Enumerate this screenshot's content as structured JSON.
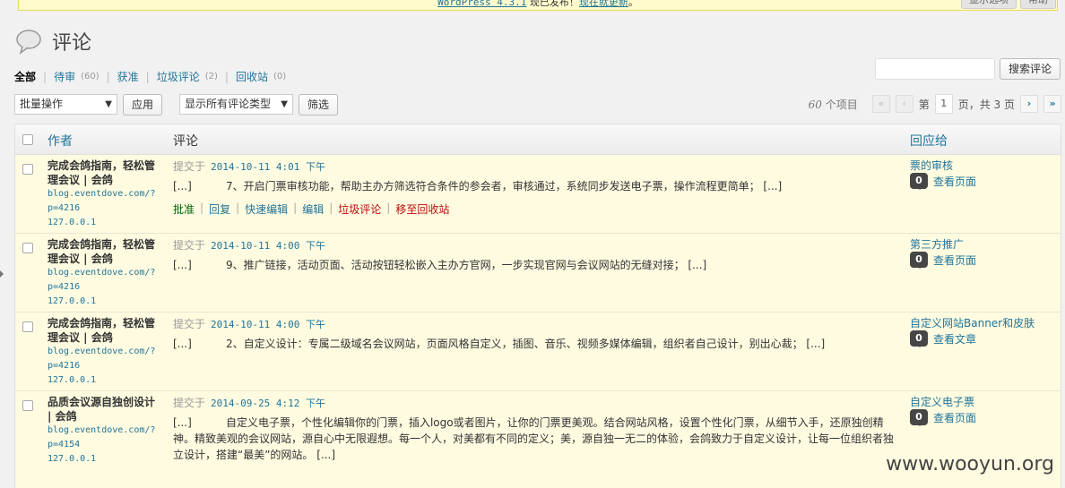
{
  "notice": {
    "product": "WordPress 4.3.1",
    "text": "现已发布！",
    "link": "现在就更新",
    "end": "。"
  },
  "screen_tabs": {
    "options": "显示选项",
    "help": "帮助"
  },
  "page": {
    "title": "评论"
  },
  "filters": [
    {
      "label": "全部",
      "count": ""
    },
    {
      "label": "待审",
      "count": "(60)"
    },
    {
      "label": "获准",
      "count": ""
    },
    {
      "label": "垃圾评论",
      "count": "(2)"
    },
    {
      "label": "回收站",
      "count": "(0)"
    }
  ],
  "search": {
    "value": "",
    "button": "搜索评论"
  },
  "tablenav": {
    "bulk": "批量操作",
    "apply": "应用",
    "type_filter": "显示所有评论类型",
    "filter": "筛选",
    "items_count": "60",
    "items_label": "个项目",
    "page_prefix": "第",
    "current_page": "1",
    "page_suffix": "页，共 3 页",
    "first": "«",
    "prev": "‹",
    "next": "›",
    "last": "»"
  },
  "columns": {
    "author": "作者",
    "comment": "评论",
    "response": "回应给"
  },
  "rows": [
    {
      "author": "完成会鸽指南，轻松管理会议 | 会鸽",
      "url": "blog.eventdove.com/?p=4216",
      "ip": "127.0.0.1",
      "submitted": "提交于",
      "date": "2014-10-11 4:01 下午",
      "text": "[...]          7、开启门票审核功能，帮助主办方筛选符合条件的参会者，审核通过，系统同步发送电子票，操作流程更简单； [...]",
      "actions": [
        "批准",
        "回复",
        "快速编辑",
        "编辑",
        "垃圾评论",
        "移至回收站"
      ],
      "response_title": "票的审核",
      "response_count": "0",
      "response_view": "查看页面"
    },
    {
      "author": "完成会鸽指南，轻松管理会议 | 会鸽",
      "url": "blog.eventdove.com/?p=4216",
      "ip": "127.0.0.1",
      "submitted": "提交于",
      "date": "2014-10-11 4:00 下午",
      "text": "[...]          9、推广链接，活动页面、活动按钮轻松嵌入主办方官网，一步实现官网与会议网站的无缝对接； [...]",
      "actions": [],
      "response_title": "第三方推广",
      "response_count": "0",
      "response_view": "查看页面"
    },
    {
      "author": "完成会鸽指南，轻松管理会议 | 会鸽",
      "url": "blog.eventdove.com/?p=4216",
      "ip": "127.0.0.1",
      "submitted": "提交于",
      "date": "2014-10-11 4:00 下午",
      "text": "[...]          2、自定义设计：专属二级域名会议网站，页面风格自定义，插图、音乐、视频多媒体编辑，组织者自己设计，别出心裁； [...]",
      "actions": [],
      "response_title": "自定义网站Banner和皮肤",
      "response_count": "0",
      "response_view": "查看文章"
    },
    {
      "author": "品质会议源自独创设计 | 会鸽",
      "url": "blog.eventdove.com/?p=4154",
      "ip": "127.0.0.1",
      "submitted": "提交于",
      "date": "2014-09-25 4:12 下午",
      "text": "[...]          自定义电子票，个性化编辑你的门票，插入logo或者图片，让你的门票更美观。结合网站风格，设置个性化门票，从细节入手，还原独创精神。精致美观的会议网站，源自心中无限遐想。每一个人，对美都有不同的定义；美，源自独一无二的体验，会鸽致力于自定义设计，让每一位组织者独立设计，搭建“最美”的网站。 [...]",
      "actions": [],
      "response_title": "自定义电子票",
      "response_count": "0",
      "response_view": "查看页面"
    }
  ],
  "watermark": "www.wooyun.org"
}
